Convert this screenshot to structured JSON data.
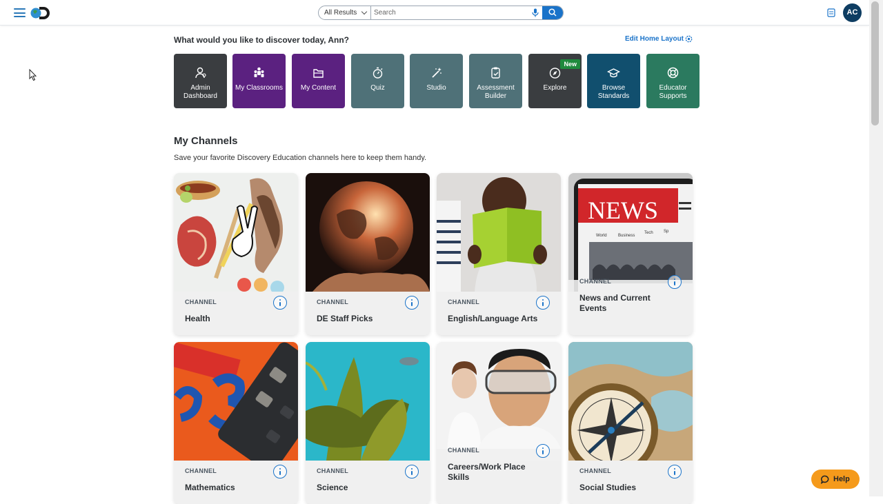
{
  "header": {
    "search_scope": "All Results",
    "search_placeholder": "Search",
    "avatar_initials": "AC"
  },
  "greeting": "What would you like to discover today, Ann?",
  "edit_layout_label": "Edit Home Layout",
  "tiles": [
    {
      "label": "Admin Dashboard",
      "color": "#3a3d40",
      "icon": "admin-icon"
    },
    {
      "label": "My Classrooms",
      "color": "#5b2180",
      "icon": "classrooms-icon"
    },
    {
      "label": "My Content",
      "color": "#5b2180",
      "icon": "folder-icon"
    },
    {
      "label": "Quiz",
      "color": "#4f7178",
      "icon": "stopwatch-icon"
    },
    {
      "label": "Studio",
      "color": "#4f7178",
      "icon": "wand-icon"
    },
    {
      "label": "Assessment Builder",
      "color": "#4f7178",
      "icon": "clipboard-icon"
    },
    {
      "label": "Explore",
      "color": "#3a3d40",
      "icon": "compass-icon",
      "badge": "New"
    },
    {
      "label": "Browse Standards",
      "color": "#114f6e",
      "icon": "graduation-cap-icon"
    },
    {
      "label": "Educator Supports",
      "color": "#2b7a5f",
      "icon": "lifebuoy-icon"
    }
  ],
  "channels_section": {
    "title": "My Channels",
    "subtitle": "Save your favorite Discovery Education channels here to keep them handy."
  },
  "channels": [
    {
      "tag": "CHANNEL",
      "name": "Health"
    },
    {
      "tag": "CHANNEL",
      "name": "DE Staff Picks"
    },
    {
      "tag": "CHANNEL",
      "name": "English/Language Arts"
    },
    {
      "tag": "CHANNEL",
      "name": "News and Current Events"
    },
    {
      "tag": "CHANNEL",
      "name": "Mathematics"
    },
    {
      "tag": "CHANNEL",
      "name": "Science"
    },
    {
      "tag": "CHANNEL",
      "name": "Careers/Work Place Skills"
    },
    {
      "tag": "CHANNEL",
      "name": "Social Studies"
    }
  ],
  "help_label": "Help",
  "news_image_text": {
    "headline": "NEWS",
    "nav": [
      "World",
      "Business",
      "Tech",
      "Sp"
    ]
  }
}
